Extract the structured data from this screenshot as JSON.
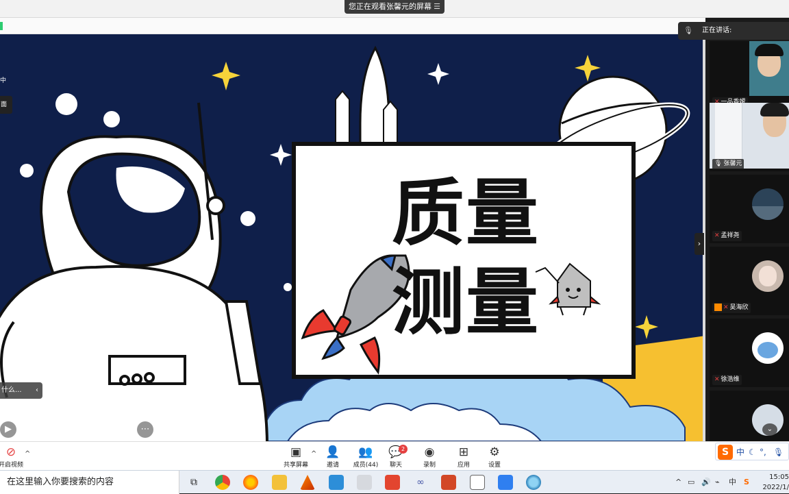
{
  "banner": {
    "text": "您正在观看张馨元的屏幕",
    "options_icon": "menu-lines-icon"
  },
  "slide": {
    "title_line1": "质量",
    "title_line2": "测量"
  },
  "left_overlay": {
    "pill_text": "什么..."
  },
  "speaking": {
    "label": "正在讲话:"
  },
  "participants": [
    {
      "name": "一品香嫒",
      "mic": "muted"
    },
    {
      "name": "张馨元",
      "mic": "on"
    },
    {
      "name": "孟祥尧",
      "mic": "muted"
    },
    {
      "name": "吴海欣",
      "mic": "muted"
    },
    {
      "name": "徐浩维",
      "mic": "muted"
    }
  ],
  "toolbar": {
    "video": "开启视频",
    "share": "共享屏幕",
    "invite": "邀请",
    "members": "成员(44)",
    "chat": "聊天",
    "chat_badge": "2",
    "record": "录制",
    "apps": "应用",
    "settings": "设置"
  },
  "ime": {
    "lang": "中"
  },
  "taskbar": {
    "search_placeholder": "在这里输入你要搜索的内容",
    "tray_lang": "中",
    "time": "15:05",
    "date": "2022/1/"
  },
  "colors": {
    "space": "#0f1f4a",
    "accent_orange": "#ff6a00",
    "muted_red": "#e54040"
  }
}
